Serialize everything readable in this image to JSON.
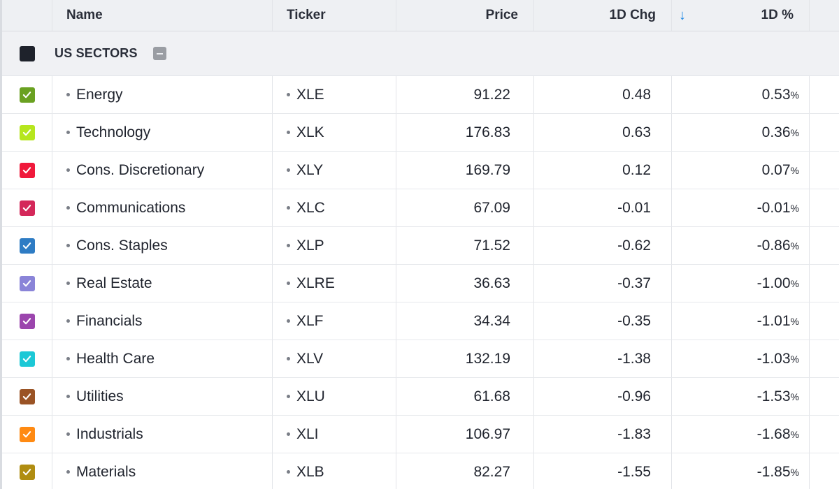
{
  "header": {
    "name": "Name",
    "ticker": "Ticker",
    "price": "Price",
    "chg": "1D Chg",
    "sort_icon": "arrow-down-icon",
    "pct": "1D %"
  },
  "section": {
    "label": "US SECTORS",
    "swatch_color": "#1e222b"
  },
  "colors": {
    "positive": "#1b8a47",
    "negative": "#e0413a",
    "sort_accent": "#1e88e5"
  },
  "rows": [
    {
      "name": "Energy",
      "ticker": "XLE",
      "price": "91.22",
      "chg": "0.48",
      "pct": "0.53",
      "pct_sign": "%",
      "direction": "positive",
      "color": "#6aa121"
    },
    {
      "name": "Technology",
      "ticker": "XLK",
      "price": "176.83",
      "chg": "0.63",
      "pct": "0.36",
      "pct_sign": "%",
      "direction": "positive",
      "color": "#b6e61e"
    },
    {
      "name": "Cons. Discretionary",
      "ticker": "XLY",
      "price": "169.79",
      "chg": "0.12",
      "pct": "0.07",
      "pct_sign": "%",
      "direction": "positive",
      "color": "#f0193b"
    },
    {
      "name": "Communications",
      "ticker": "XLC",
      "price": "67.09",
      "chg": "-0.01",
      "pct": "-0.01",
      "pct_sign": "%",
      "direction": "negative",
      "color": "#d4285a"
    },
    {
      "name": "Cons. Staples",
      "ticker": "XLP",
      "price": "71.52",
      "chg": "-0.62",
      "pct": "-0.86",
      "pct_sign": "%",
      "direction": "negative",
      "color": "#2e7cc4"
    },
    {
      "name": "Real Estate",
      "ticker": "XLRE",
      "price": "36.63",
      "chg": "-0.37",
      "pct": "-1.00",
      "pct_sign": "%",
      "direction": "negative",
      "color": "#8a84d8"
    },
    {
      "name": "Financials",
      "ticker": "XLF",
      "price": "34.34",
      "chg": "-0.35",
      "pct": "-1.01",
      "pct_sign": "%",
      "direction": "negative",
      "color": "#9b45ad"
    },
    {
      "name": "Health Care",
      "ticker": "XLV",
      "price": "132.19",
      "chg": "-1.38",
      "pct": "-1.03",
      "pct_sign": "%",
      "direction": "negative",
      "color": "#1cc8d6"
    },
    {
      "name": "Utilities",
      "ticker": "XLU",
      "price": "61.68",
      "chg": "-0.96",
      "pct": "-1.53",
      "pct_sign": "%",
      "direction": "negative",
      "color": "#9a5325"
    },
    {
      "name": "Industrials",
      "ticker": "XLI",
      "price": "106.97",
      "chg": "-1.83",
      "pct": "-1.68",
      "pct_sign": "%",
      "direction": "negative",
      "color": "#ff8a12"
    },
    {
      "name": "Materials",
      "ticker": "XLB",
      "price": "82.27",
      "chg": "-1.55",
      "pct": "-1.85",
      "pct_sign": "%",
      "direction": "negative",
      "color": "#b08d11"
    }
  ]
}
